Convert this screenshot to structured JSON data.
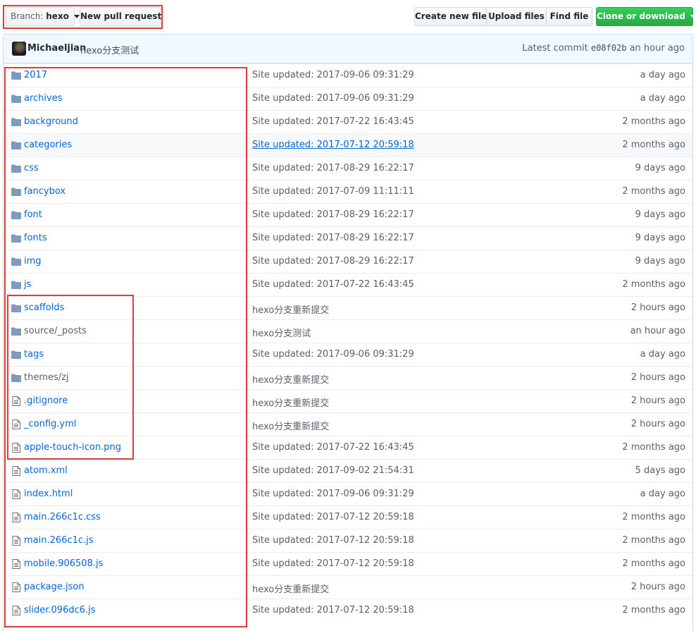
{
  "toolbar": {
    "branch_label": "Branch:",
    "branch_value": "hexo",
    "new_pull_request": "New pull request",
    "create_new_file": "Create new file",
    "upload_files": "Upload files",
    "find_file": "Find file",
    "clone_or_download": "Clone or download",
    "clone_color": "#28a745"
  },
  "commit": {
    "author": "Michaeljian",
    "message": "hexo分支测试",
    "latest_label": "Latest commit",
    "sha": "e08f02b",
    "age": "an hour ago"
  },
  "files": [
    {
      "type": "folder",
      "name": "2017",
      "message": "Site updated: 2017-09-06 09:31:29",
      "age": "a day ago"
    },
    {
      "type": "folder",
      "name": "archives",
      "message": "Site updated: 2017-09-06 09:31:29",
      "age": "a day ago"
    },
    {
      "type": "folder",
      "name": "background",
      "message": "Site updated: 2017-07-22 16:43:45",
      "age": "2 months ago"
    },
    {
      "type": "folder",
      "name": "categories",
      "message": "Site updated: 2017-07-12 20:59:18",
      "age": "2 months ago",
      "hovered": true
    },
    {
      "type": "folder",
      "name": "css",
      "message": "Site updated: 2017-08-29 16:22:17",
      "age": "9 days ago"
    },
    {
      "type": "folder",
      "name": "fancybox",
      "message": "Site updated: 2017-07-09 11:11:11",
      "age": "2 months ago"
    },
    {
      "type": "folder",
      "name": "font",
      "message": "Site updated: 2017-08-29 16:22:17",
      "age": "9 days ago"
    },
    {
      "type": "folder",
      "name": "fonts",
      "message": "Site updated: 2017-08-29 16:22:17",
      "age": "9 days ago"
    },
    {
      "type": "folder",
      "name": "img",
      "message": "Site updated: 2017-08-29 16:22:17",
      "age": "9 days ago"
    },
    {
      "type": "folder",
      "name": "js",
      "message": "Site updated: 2017-07-22 16:43:45",
      "age": "2 months ago"
    },
    {
      "type": "folder",
      "name": "scaffolds",
      "message": "hexo分支重新提交",
      "age": "2 hours ago"
    },
    {
      "type": "folder",
      "name": "source/_posts",
      "message": "hexo分支测试",
      "age": "an hour ago",
      "muted": true
    },
    {
      "type": "folder",
      "name": "tags",
      "message": "Site updated: 2017-09-06 09:31:29",
      "age": "a day ago"
    },
    {
      "type": "folder",
      "name": "themes/zj",
      "message": "hexo分支重新提交",
      "age": "2 hours ago",
      "muted": true
    },
    {
      "type": "file",
      "name": ".gitignore",
      "message": "hexo分支重新提交",
      "age": "2 hours ago"
    },
    {
      "type": "file",
      "name": "_config.yml",
      "message": "hexo分支重新提交",
      "age": "2 hours ago"
    },
    {
      "type": "file",
      "name": "apple-touch-icon.png",
      "message": "Site updated: 2017-07-22 16:43:45",
      "age": "2 months ago"
    },
    {
      "type": "file",
      "name": "atom.xml",
      "message": "Site updated: 2017-09-02 21:54:31",
      "age": "5 days ago"
    },
    {
      "type": "file",
      "name": "index.html",
      "message": "Site updated: 2017-09-06 09:31:29",
      "age": "a day ago"
    },
    {
      "type": "file",
      "name": "main.266c1c.css",
      "message": "Site updated: 2017-07-12 20:59:18",
      "age": "2 months ago"
    },
    {
      "type": "file",
      "name": "main.266c1c.js",
      "message": "Site updated: 2017-07-12 20:59:18",
      "age": "2 months ago"
    },
    {
      "type": "file",
      "name": "mobile.906508.js",
      "message": "Site updated: 2017-07-12 20:59:18",
      "age": "2 months ago"
    },
    {
      "type": "file",
      "name": "package.json",
      "message": "hexo分支重新提交",
      "age": "2 hours ago"
    },
    {
      "type": "file",
      "name": "slider.096dc6.js",
      "message": "Site updated: 2017-07-12 20:59:18",
      "age": "2 months ago"
    }
  ],
  "colors": {
    "link": "#0366d6",
    "muted": "#586069",
    "annotation": "#e03a3a",
    "commit_bar_bg": "#f1f8ff"
  }
}
